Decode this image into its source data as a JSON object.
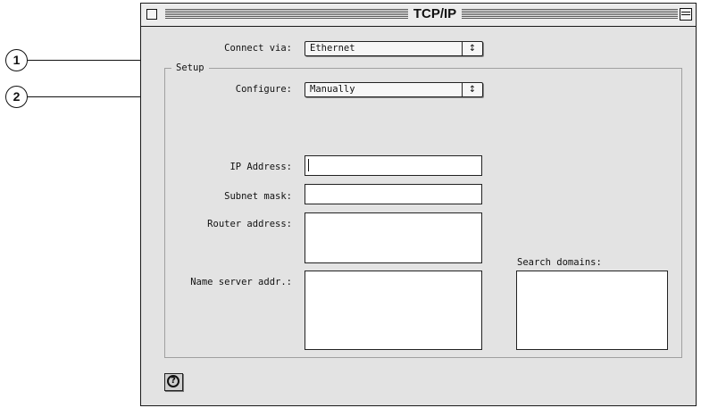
{
  "window": {
    "title": "TCP/IP"
  },
  "connect_via": {
    "label": "Connect via:",
    "value": "Ethernet"
  },
  "setup": {
    "group_label": "Setup",
    "configure_label": "Configure:",
    "configure_value": "Manually",
    "ip_address_label": "IP Address:",
    "ip_address_value": "",
    "subnet_mask_label": "Subnet mask:",
    "subnet_mask_value": "",
    "router_address_label": "Router address:",
    "router_address_value": "",
    "name_server_label": "Name server addr.:",
    "name_server_value": "",
    "search_domains_label": "Search domains:",
    "search_domains_value": ""
  },
  "popup_arrow_glyph": "↕",
  "callouts": [
    "1",
    "2"
  ],
  "icons": {
    "close": "close-box-icon",
    "zoom": "zoom-box-icon",
    "help": "help-icon"
  }
}
